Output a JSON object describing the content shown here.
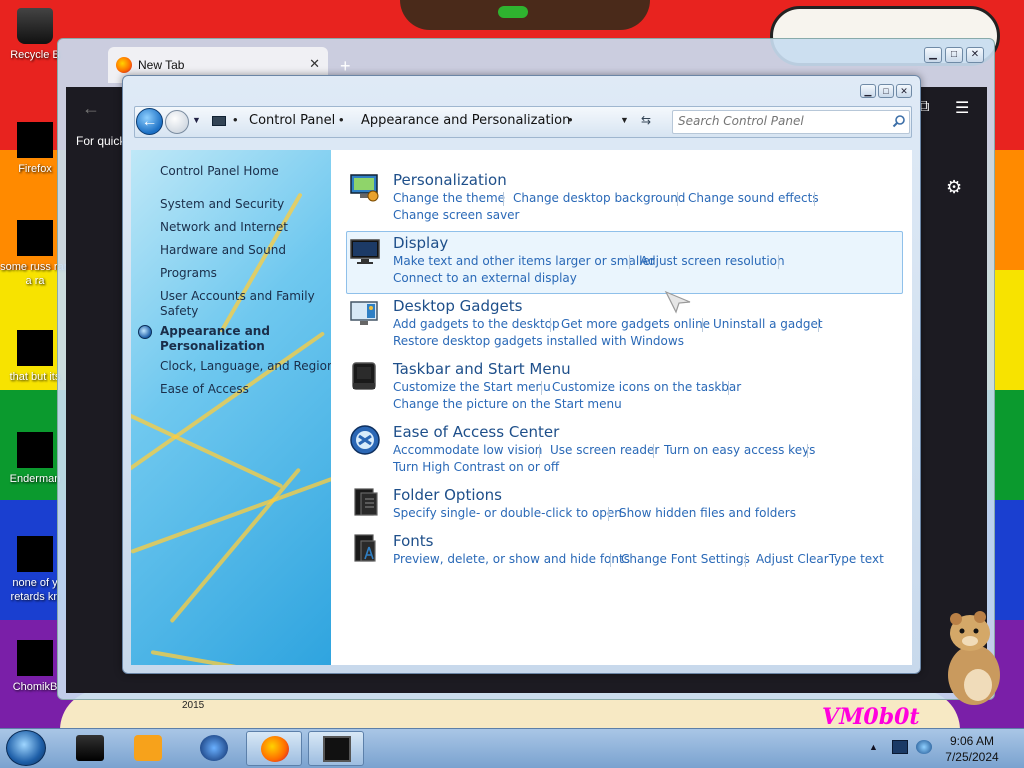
{
  "desktop": {
    "wallpaper_text": "VM0b0t",
    "year_text": "2015",
    "icons": [
      {
        "label": "Recycle B"
      },
      {
        "label": "Firefox"
      },
      {
        "label": "some russ ran a ra"
      },
      {
        "label": "that but its"
      },
      {
        "label": "Enderman"
      },
      {
        "label": "none of y retards kn"
      },
      {
        "label": "ChomikB"
      }
    ]
  },
  "firefox": {
    "tab_title": "New Tab",
    "tab_close": "✕",
    "new_tab": "+",
    "back": "←",
    "quick_text": "For quick"
  },
  "control_panel": {
    "breadcrumb": [
      "Control Panel",
      "Appearance and Personalization"
    ],
    "search_placeholder": "Search Control Panel",
    "left_nav": [
      {
        "label": "Control Panel Home"
      },
      {
        "label": "System and Security"
      },
      {
        "label": "Network and Internet"
      },
      {
        "label": "Hardware and Sound"
      },
      {
        "label": "Programs"
      },
      {
        "label": "User Accounts and Family Safety"
      },
      {
        "label": "Appearance and Personalization",
        "current": true
      },
      {
        "label": "Clock, Language, and Region"
      },
      {
        "label": "Ease of Access"
      }
    ],
    "categories": [
      {
        "title": "Personalization",
        "icon": "personalization-icon",
        "links": [
          "Change the theme",
          "Change desktop background",
          "Change sound effects",
          "Change screen saver"
        ]
      },
      {
        "title": "Display",
        "icon": "display-icon",
        "links": [
          "Make text and other items larger or smaller",
          "Adjust screen resolution",
          "Connect to an external display"
        ]
      },
      {
        "title": "Desktop Gadgets",
        "icon": "gadgets-icon",
        "links": [
          "Add gadgets to the desktop",
          "Get more gadgets online",
          "Uninstall a gadget",
          "Restore desktop gadgets installed with Windows"
        ]
      },
      {
        "title": "Taskbar and Start Menu",
        "icon": "taskbar-icon",
        "links": [
          "Customize the Start menu",
          "Customize icons on the taskbar",
          "Change the picture on the Start menu"
        ]
      },
      {
        "title": "Ease of Access Center",
        "icon": "ease-of-access-icon",
        "links": [
          "Accommodate low vision",
          "Use screen reader",
          "Turn on easy access keys",
          "Turn High Contrast on or off"
        ]
      },
      {
        "title": "Folder Options",
        "icon": "folder-options-icon",
        "links": [
          "Specify single- or double-click to open",
          "Show hidden files and folders"
        ]
      },
      {
        "title": "Fonts",
        "icon": "fonts-icon",
        "links": [
          "Preview, delete, or show and hide fonts",
          "Change Font Settings",
          "Adjust ClearType text"
        ]
      }
    ]
  },
  "taskbar": {
    "time": "9:06 AM",
    "date": "7/25/2024"
  }
}
